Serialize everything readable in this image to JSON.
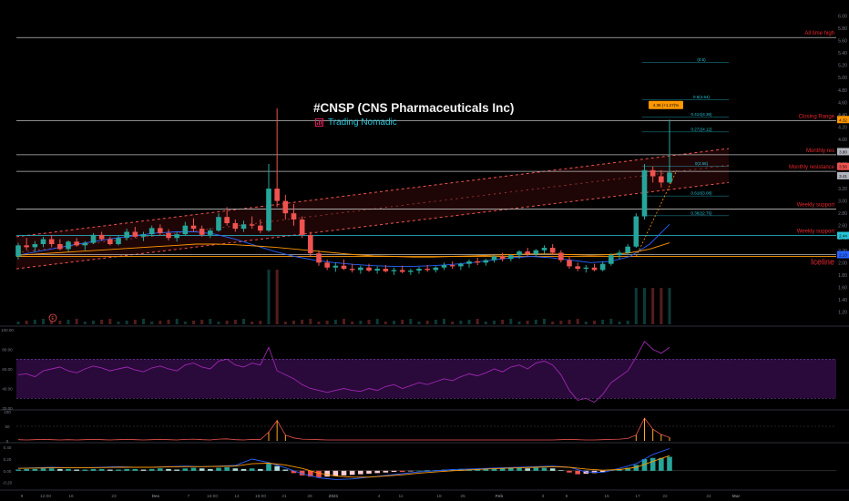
{
  "header": {
    "title": "#CNSP (CNS Pharmaceuticals Inc)",
    "author": "Trading Nomadic"
  },
  "colors": {
    "background": "#000000",
    "bull": "#26a69a",
    "bear": "#ef5350",
    "label_red": "#e8262c",
    "rsi_line": "#7b1fa2",
    "rsi_band": "#2a0a3a",
    "ema_blue": "#2962ff",
    "ema_orange": "#ff9800",
    "fib_teal": "#26c6da"
  },
  "chart_data": [
    {
      "type": "candlestick",
      "name": "price",
      "x_ticks": [
        "9",
        "12:00",
        "16",
        "23",
        "Dec",
        "7",
        "16:00",
        "14",
        "16:00",
        "21",
        "28",
        "2021",
        "4",
        "11",
        "18",
        "25",
        "Feb",
        "3",
        "8",
        "15",
        "17",
        "22",
        "24",
        "Mar"
      ],
      "y_ticks": [
        "6.00",
        "5.80",
        "5.60",
        "5.40",
        "5.20",
        "5.00",
        "4.80",
        "4.60",
        "4.40",
        "4.20",
        "4.00",
        "3.80",
        "3.60",
        "3.40",
        "3.20",
        "3.00",
        "2.80",
        "2.60",
        "2.40",
        "2.20",
        "2.00",
        "1.80",
        "1.60",
        "1.40",
        "1.20"
      ],
      "ylim": [
        1.0,
        6.2
      ],
      "candles": [
        [
          2.1,
          2.32,
          2.05,
          2.28
        ],
        [
          2.28,
          2.4,
          2.2,
          2.25
        ],
        [
          2.25,
          2.35,
          2.18,
          2.3
        ],
        [
          2.3,
          2.42,
          2.25,
          2.38
        ],
        [
          2.38,
          2.45,
          2.25,
          2.3
        ],
        [
          2.3,
          2.38,
          2.2,
          2.22
        ],
        [
          2.22,
          2.36,
          2.18,
          2.34
        ],
        [
          2.34,
          2.4,
          2.26,
          2.28
        ],
        [
          2.28,
          2.35,
          2.2,
          2.32
        ],
        [
          2.32,
          2.48,
          2.3,
          2.45
        ],
        [
          2.45,
          2.5,
          2.35,
          2.38
        ],
        [
          2.38,
          2.42,
          2.28,
          2.3
        ],
        [
          2.3,
          2.44,
          2.28,
          2.4
        ],
        [
          2.4,
          2.55,
          2.36,
          2.5
        ],
        [
          2.5,
          2.58,
          2.4,
          2.42
        ],
        [
          2.42,
          2.5,
          2.35,
          2.46
        ],
        [
          2.46,
          2.6,
          2.42,
          2.56
        ],
        [
          2.56,
          2.62,
          2.44,
          2.48
        ],
        [
          2.48,
          2.54,
          2.36,
          2.4
        ],
        [
          2.4,
          2.5,
          2.34,
          2.46
        ],
        [
          2.46,
          2.66,
          2.44,
          2.6
        ],
        [
          2.6,
          2.72,
          2.5,
          2.55
        ],
        [
          2.55,
          2.6,
          2.42,
          2.45
        ],
        [
          2.45,
          2.56,
          2.4,
          2.52
        ],
        [
          2.52,
          2.8,
          2.5,
          2.74
        ],
        [
          2.74,
          2.9,
          2.6,
          2.64
        ],
        [
          2.64,
          2.7,
          2.5,
          2.55
        ],
        [
          2.55,
          2.68,
          2.5,
          2.62
        ],
        [
          2.62,
          2.75,
          2.55,
          2.6
        ],
        [
          2.6,
          2.7,
          2.48,
          2.52
        ],
        [
          2.52,
          3.6,
          2.5,
          3.2
        ],
        [
          3.2,
          4.5,
          2.9,
          3.0
        ],
        [
          3.0,
          3.1,
          2.7,
          2.8
        ],
        [
          2.8,
          2.95,
          2.6,
          2.7
        ],
        [
          2.7,
          2.75,
          2.4,
          2.45
        ],
        [
          2.45,
          2.5,
          2.1,
          2.15
        ],
        [
          2.15,
          2.2,
          1.95,
          2.0
        ],
        [
          2.0,
          2.05,
          1.88,
          1.92
        ],
        [
          1.92,
          2.0,
          1.85,
          1.95
        ],
        [
          1.95,
          2.05,
          1.88,
          1.9
        ],
        [
          1.9,
          1.98,
          1.84,
          1.88
        ],
        [
          1.88,
          1.95,
          1.82,
          1.92
        ],
        [
          1.92,
          1.98,
          1.85,
          1.87
        ],
        [
          1.87,
          1.94,
          1.82,
          1.9
        ],
        [
          1.9,
          1.96,
          1.84,
          1.86
        ],
        [
          1.86,
          1.92,
          1.8,
          1.88
        ],
        [
          1.88,
          1.95,
          1.83,
          1.85
        ],
        [
          1.85,
          1.9,
          1.8,
          1.87
        ],
        [
          1.87,
          1.93,
          1.82,
          1.9
        ],
        [
          1.9,
          1.96,
          1.85,
          1.88
        ],
        [
          1.88,
          1.94,
          1.84,
          1.92
        ],
        [
          1.92,
          2.0,
          1.88,
          1.96
        ],
        [
          1.96,
          2.02,
          1.9,
          1.94
        ],
        [
          1.94,
          2.0,
          1.88,
          1.98
        ],
        [
          1.98,
          2.05,
          1.92,
          2.02
        ],
        [
          2.02,
          2.08,
          1.96,
          2.0
        ],
        [
          2.0,
          2.06,
          1.95,
          2.04
        ],
        [
          2.04,
          2.12,
          2.0,
          2.1
        ],
        [
          2.1,
          2.16,
          2.02,
          2.06
        ],
        [
          2.06,
          2.14,
          2.02,
          2.12
        ],
        [
          2.12,
          2.2,
          2.06,
          2.18
        ],
        [
          2.18,
          2.24,
          2.1,
          2.14
        ],
        [
          2.14,
          2.22,
          2.1,
          2.2
        ],
        [
          2.2,
          2.28,
          2.14,
          2.24
        ],
        [
          2.24,
          2.3,
          2.12,
          2.16
        ],
        [
          2.16,
          2.2,
          2.0,
          2.04
        ],
        [
          2.04,
          2.1,
          1.9,
          1.94
        ],
        [
          1.94,
          2.0,
          1.86,
          1.9
        ],
        [
          1.9,
          1.96,
          1.84,
          1.92
        ],
        [
          1.92,
          1.98,
          1.86,
          1.88
        ],
        [
          1.88,
          2.02,
          1.86,
          1.98
        ],
        [
          1.98,
          2.15,
          1.95,
          2.12
        ],
        [
          2.12,
          2.2,
          2.06,
          2.16
        ],
        [
          2.16,
          2.3,
          2.12,
          2.26
        ],
        [
          2.26,
          2.8,
          2.24,
          2.75
        ],
        [
          2.75,
          3.6,
          2.7,
          3.5
        ],
        [
          3.5,
          3.56,
          3.3,
          3.4
        ],
        [
          3.4,
          3.5,
          3.22,
          3.3
        ],
        [
          3.3,
          4.32,
          3.28,
          3.46
        ]
      ],
      "moving_averages": [
        {
          "color": "#2962ff",
          "values": [
            2.12,
            2.18,
            2.24,
            2.3,
            2.35,
            2.4,
            2.44,
            2.48,
            2.5,
            2.5,
            2.46,
            2.38,
            2.28,
            2.18,
            2.1,
            2.04,
            2.0,
            1.97,
            1.95,
            1.94,
            1.94,
            1.95,
            1.97,
            2.0,
            2.04,
            2.08,
            2.1,
            2.08,
            2.04,
            2.0,
            2.02,
            2.1,
            2.3,
            2.62
          ]
        },
        {
          "color": "#ff9800",
          "values": [
            2.12,
            2.14,
            2.16,
            2.18,
            2.2,
            2.22,
            2.24,
            2.26,
            2.28,
            2.3,
            2.3,
            2.29,
            2.27,
            2.25,
            2.22,
            2.19,
            2.16,
            2.13,
            2.11,
            2.1,
            2.09,
            2.09,
            2.1,
            2.11,
            2.12,
            2.13,
            2.14,
            2.14,
            2.13,
            2.12,
            2.13,
            2.16,
            2.22,
            2.32
          ]
        }
      ],
      "h_levels": [
        {
          "value": 5.65,
          "label": "All time high",
          "color": "#bdbdbd"
        },
        {
          "value": 4.3,
          "label": "Closing Range",
          "color": "#bdbdbd"
        },
        {
          "value": 3.75,
          "label": "Monthly res",
          "color": "#bdbdbd"
        },
        {
          "value": 3.48,
          "label": "Monthly resistance",
          "color": "#bdbdbd"
        },
        {
          "value": 2.87,
          "label": "Weekly support",
          "color": "#bdbdbd"
        },
        {
          "value": 2.44,
          "label": "Weekly support",
          "color": "#26c6da"
        },
        {
          "value": 2.13,
          "label": "Iceline",
          "color": "#bdbdbd"
        },
        {
          "value": 2.1,
          "label": "",
          "color": "#ff9800"
        }
      ],
      "fib_levels": [
        {
          "value": 5.25,
          "label": "(0.5)"
        },
        {
          "value": 4.64,
          "label": "0.5(4.64)"
        },
        {
          "value": 4.36,
          "label": "0.414(4.36)"
        },
        {
          "value": 4.12,
          "label": "0.272(4.12)"
        },
        {
          "value": 3.56,
          "label": "0(3.56)"
        },
        {
          "value": 3.08,
          "label": "0.618(3.08)"
        },
        {
          "value": 2.76,
          "label": "0.382(2.76)"
        }
      ],
      "price_marker_label": "4.36 (+1.27)%",
      "axis_badges": [
        "4.32",
        "3.80",
        "3.56",
        "3.41",
        "2.44",
        "2.13"
      ]
    },
    {
      "type": "line",
      "name": "rsi",
      "y_ticks": [
        "100.00",
        "80.00",
        "60.00",
        "40.00",
        "20.00"
      ],
      "ylim": [
        20,
        100
      ],
      "band": [
        30,
        70
      ],
      "values": [
        54,
        55,
        52,
        58,
        60,
        62,
        58,
        56,
        60,
        63,
        61,
        58,
        60,
        62,
        59,
        57,
        61,
        63,
        60,
        58,
        64,
        66,
        62,
        60,
        68,
        70,
        64,
        62,
        66,
        64,
        82,
        58,
        54,
        50,
        44,
        40,
        38,
        36,
        38,
        40,
        38,
        37,
        40,
        38,
        42,
        44,
        40,
        43,
        46,
        44,
        47,
        50,
        48,
        52,
        55,
        53,
        56,
        60,
        57,
        62,
        64,
        60,
        66,
        68,
        64,
        54,
        38,
        28,
        30,
        26,
        34,
        46,
        52,
        58,
        72,
        88,
        80,
        76,
        82
      ]
    },
    {
      "type": "bar",
      "name": "volume-oscillator",
      "y_ticks": [
        "100",
        "50",
        "0"
      ],
      "ylim": [
        0,
        100
      ],
      "values": [
        4,
        3,
        4,
        5,
        4,
        3,
        4,
        3,
        4,
        5,
        4,
        3,
        4,
        5,
        4,
        3,
        4,
        5,
        4,
        3,
        5,
        6,
        4,
        3,
        6,
        7,
        4,
        3,
        5,
        4,
        30,
        70,
        20,
        10,
        6,
        5,
        4,
        3,
        3,
        3,
        3,
        3,
        3,
        3,
        3,
        3,
        3,
        3,
        3,
        3,
        3,
        3,
        3,
        3,
        3,
        3,
        3,
        3,
        3,
        3,
        3,
        3,
        3,
        3,
        3,
        4,
        5,
        4,
        3,
        3,
        4,
        5,
        6,
        8,
        20,
        78,
        40,
        22,
        12
      ]
    },
    {
      "type": "histogram",
      "name": "macd",
      "y_ticks": [
        "0.40",
        "0.20",
        "0.00",
        "-0.20"
      ],
      "ylim": [
        -0.3,
        0.45
      ],
      "values": [
        0.02,
        0.03,
        0.03,
        0.04,
        0.04,
        0.03,
        0.03,
        0.02,
        0.02,
        0.03,
        0.03,
        0.02,
        0.02,
        0.03,
        0.03,
        0.02,
        0.03,
        0.04,
        0.03,
        0.02,
        0.04,
        0.05,
        0.04,
        0.03,
        0.05,
        0.06,
        0.04,
        0.03,
        0.04,
        0.03,
        0.12,
        0.08,
        0.02,
        -0.04,
        -0.08,
        -0.1,
        -0.11,
        -0.1,
        -0.09,
        -0.08,
        -0.07,
        -0.06,
        -0.05,
        -0.04,
        -0.03,
        -0.02,
        -0.02,
        -0.01,
        0.0,
        0.01,
        0.01,
        0.02,
        0.02,
        0.03,
        0.03,
        0.03,
        0.04,
        0.04,
        0.04,
        0.05,
        0.05,
        0.04,
        0.05,
        0.05,
        0.04,
        0.01,
        -0.03,
        -0.06,
        -0.05,
        -0.04,
        -0.02,
        0.01,
        0.03,
        0.05,
        0.1,
        0.2,
        0.22,
        0.22,
        0.24
      ],
      "macd_line": [
        0.04,
        0.05,
        0.06,
        0.05,
        0.05,
        0.06,
        0.07,
        0.06,
        0.06,
        0.07,
        0.08,
        0.07,
        0.08,
        0.09,
        0.2,
        0.14,
        0.05,
        -0.05,
        -0.12,
        -0.15,
        -0.14,
        -0.11,
        -0.08,
        -0.05,
        -0.02,
        0.0,
        0.02,
        0.03,
        0.04,
        0.05,
        0.06,
        0.07,
        0.08,
        0.06,
        -0.02,
        -0.03,
        0.04,
        0.12,
        0.28,
        0.38
      ],
      "signal_line": [
        0.04,
        0.045,
        0.05,
        0.05,
        0.05,
        0.055,
        0.06,
        0.06,
        0.06,
        0.065,
        0.07,
        0.07,
        0.075,
        0.08,
        0.12,
        0.13,
        0.1,
        0.04,
        -0.04,
        -0.09,
        -0.11,
        -0.11,
        -0.09,
        -0.07,
        -0.04,
        -0.02,
        0.0,
        0.015,
        0.03,
        0.04,
        0.05,
        0.06,
        0.07,
        0.06,
        0.03,
        0.01,
        0.02,
        0.06,
        0.16,
        0.26
      ]
    }
  ]
}
